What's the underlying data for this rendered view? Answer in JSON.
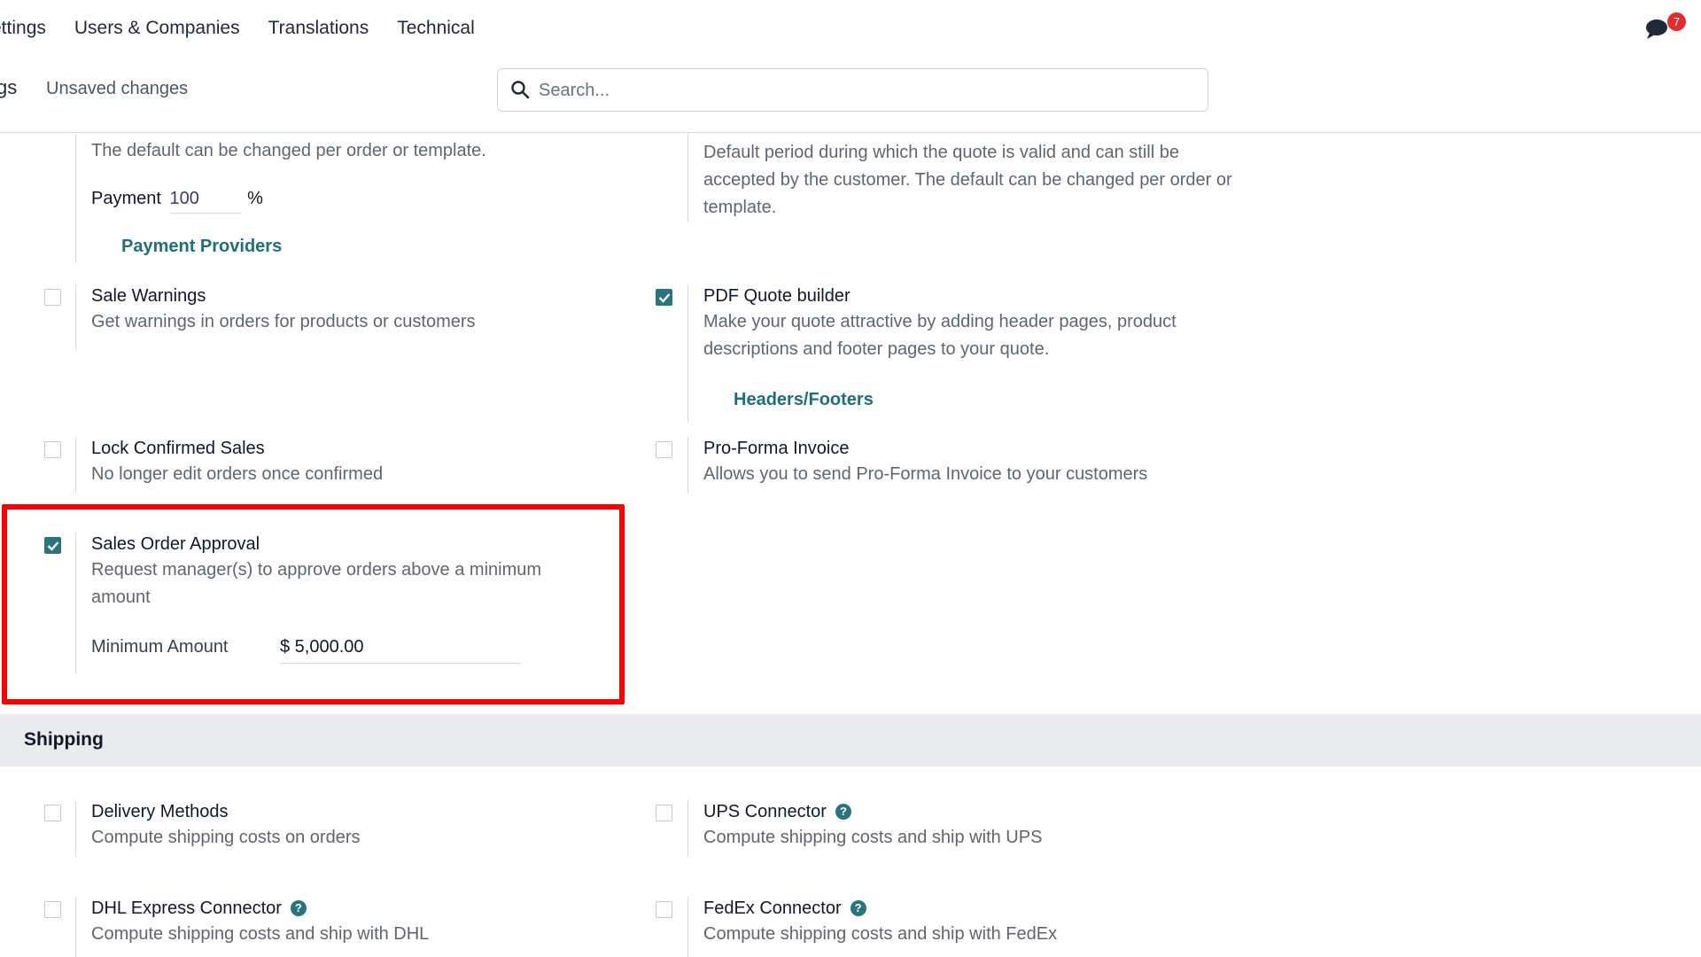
{
  "topnav": {
    "items": [
      "ettings",
      "Users & Companies",
      "Translations",
      "Technical"
    ]
  },
  "messages": {
    "badge_count": "7"
  },
  "control_panel": {
    "breadcrumb": "gs",
    "status": "Unsaved changes",
    "search_placeholder": "Search..."
  },
  "settings": {
    "payment": {
      "description": "The default can be changed per order or template.",
      "field_label": "Payment",
      "field_value": "100",
      "unit": "%",
      "link": "Payment Providers"
    },
    "quote_validity": {
      "description": "Default period during which the quote is valid and can still be accepted by the customer. The default can be changed per order or template."
    },
    "sale_warnings": {
      "title": "Sale Warnings",
      "description": "Get warnings in orders for products or customers",
      "checked": false
    },
    "pdf_quote_builder": {
      "title": "PDF Quote builder",
      "description": "Make your quote attractive by adding header pages, product descriptions and footer pages to your quote.",
      "link": "Headers/Footers",
      "checked": true
    },
    "lock_confirmed_sales": {
      "title": "Lock Confirmed Sales",
      "description": "No longer edit orders once confirmed",
      "checked": false
    },
    "pro_forma_invoice": {
      "title": "Pro-Forma Invoice",
      "description": "Allows you to send Pro-Forma Invoice to your customers",
      "checked": false
    },
    "sales_order_approval": {
      "title": "Sales Order Approval",
      "description": "Request manager(s) to approve orders above a minimum amount",
      "field_label": "Minimum Amount",
      "field_value": "$ 5,000.00",
      "checked": true
    }
  },
  "shipping": {
    "section_title": "Shipping",
    "delivery_methods": {
      "title": "Delivery Methods",
      "description": "Compute shipping costs on orders",
      "checked": false
    },
    "ups_connector": {
      "title": "UPS Connector",
      "description": "Compute shipping costs and ship with UPS",
      "checked": false
    },
    "dhl_connector": {
      "title": "DHL Express Connector",
      "description": "Compute shipping costs and ship with DHL",
      "checked": false
    },
    "fedex_connector": {
      "title": "FedEx Connector",
      "description": "Compute shipping costs and ship with FedEx",
      "checked": false
    },
    "help_glyph": "?"
  },
  "colors": {
    "accent": "#29747d",
    "link": "#1f6f78",
    "highlight": "#ff0000",
    "badge": "#e02d2d",
    "section_bg": "#e9ebee"
  }
}
